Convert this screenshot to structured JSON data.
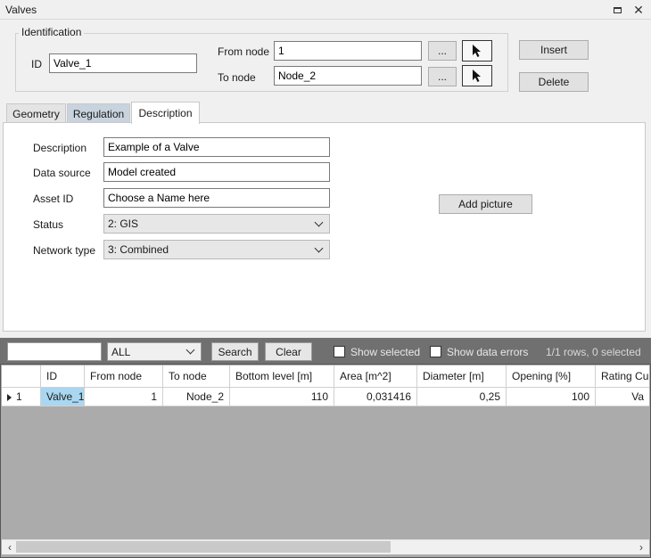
{
  "window": {
    "title": "Valves"
  },
  "identification": {
    "group_label": "Identification",
    "id_label": "ID",
    "id_value": "Valve_1",
    "from_node_label": "From node",
    "from_node_value": "1",
    "to_node_label": "To node",
    "to_node_value": "Node_2",
    "browse_label": "..."
  },
  "actions": {
    "insert": "Insert",
    "delete": "Delete"
  },
  "tabs": [
    {
      "label": "Geometry"
    },
    {
      "label": "Regulation"
    },
    {
      "label": "Description"
    }
  ],
  "description_form": {
    "description_label": "Description",
    "description_value": "Example of a Valve",
    "data_source_label": "Data source",
    "data_source_value": "Model created",
    "asset_id_label": "Asset ID",
    "asset_id_value": "Choose a Name here",
    "status_label": "Status",
    "status_value": "2: GIS",
    "network_type_label": "Network type",
    "network_type_value": "3: Combined",
    "add_picture": "Add picture"
  },
  "grid_toolbar": {
    "filter_value": "ALL",
    "search": "Search",
    "clear": "Clear",
    "show_selected": "Show selected",
    "show_data_errors": "Show data errors",
    "row_status": "1/1 rows, 0 selected"
  },
  "table": {
    "columns": [
      "ID",
      "From node",
      "To node",
      "Bottom level [m]",
      "Area [m^2]",
      "Diameter [m]",
      "Opening [%]",
      "Rating Curve"
    ],
    "rows": [
      {
        "index": "1",
        "id": "Valve_1",
        "from_node": "1",
        "to_node": "Node_2",
        "bottom_level": "110",
        "area": "0,031416",
        "diameter": "0,25",
        "opening": "100",
        "rating_curve": "Va"
      }
    ]
  },
  "icons": {
    "restore": "restore-icon",
    "close": "close-icon",
    "pick": "cursor-arrow-icon",
    "row_pointer": "row-pointer-icon"
  }
}
